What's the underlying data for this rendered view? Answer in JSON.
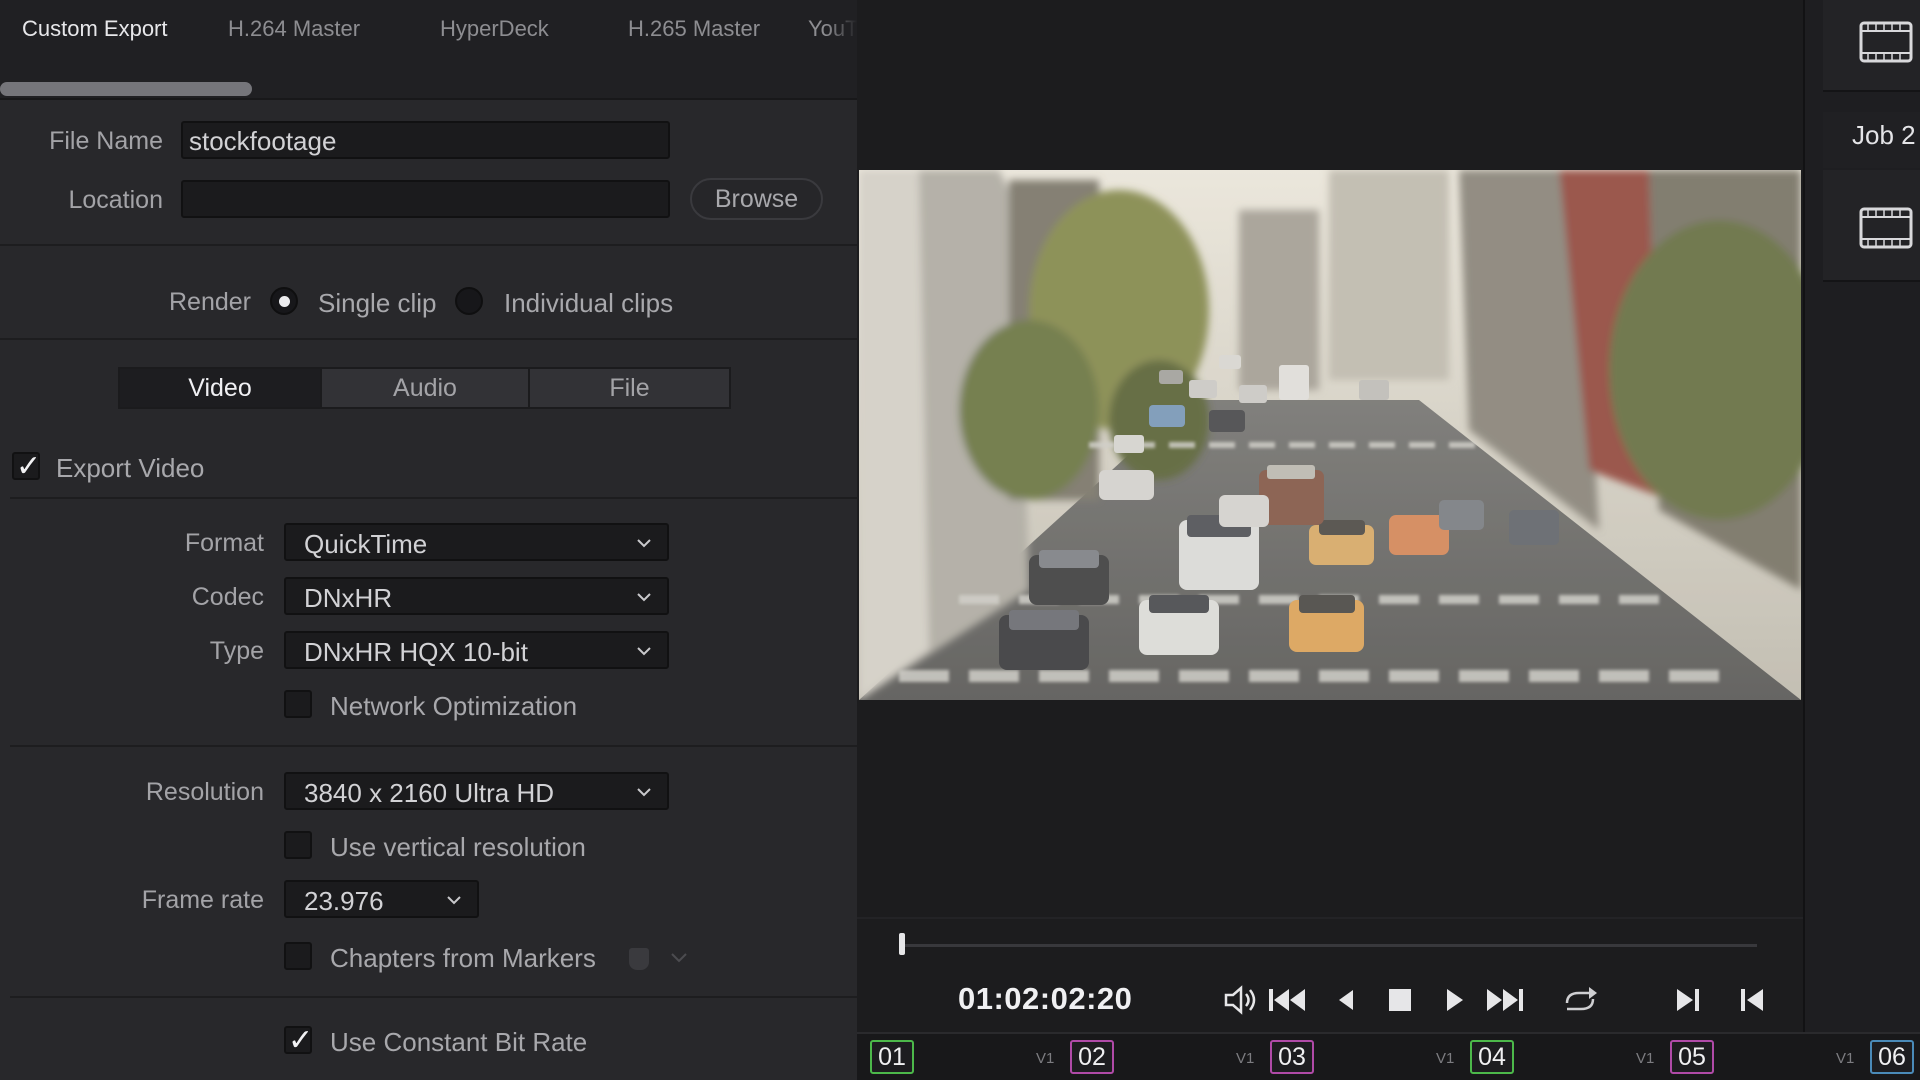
{
  "preset_tabs": [
    "Custom Export",
    "H.264 Master",
    "HyperDeck",
    "H.265 Master",
    "YouT"
  ],
  "file_name": {
    "label": "File Name",
    "value": "stockfootage"
  },
  "location": {
    "label": "Location",
    "value": "",
    "browse_label": "Browse"
  },
  "render": {
    "label": "Render",
    "options": [
      "Single clip",
      "Individual clips"
    ],
    "selected": "Single clip"
  },
  "settings_tabs": [
    "Video",
    "Audio",
    "File"
  ],
  "export_video": {
    "label": "Export Video",
    "checked": true
  },
  "format": {
    "label": "Format",
    "value": "QuickTime"
  },
  "codec": {
    "label": "Codec",
    "value": "DNxHR"
  },
  "type": {
    "label": "Type",
    "value": "DNxHR HQX 10-bit"
  },
  "network_optimization": {
    "label": "Network Optimization",
    "checked": false
  },
  "resolution": {
    "label": "Resolution",
    "value": "3840 x 2160 Ultra HD"
  },
  "vertical_resolution": {
    "label": "Use vertical resolution",
    "checked": false
  },
  "frame_rate": {
    "label": "Frame rate",
    "value": "23.976"
  },
  "chapters": {
    "label": "Chapters from Markers",
    "checked": false
  },
  "constant_bit_rate": {
    "label": "Use Constant Bit Rate",
    "checked": true
  },
  "viewer": {
    "timecode": "01:02:02:20",
    "playhead_fraction": 0.0
  },
  "transport_icons": [
    "volume-icon",
    "skip-to-start-icon",
    "step-back-icon",
    "stop-icon",
    "play-icon",
    "skip-to-end-icon",
    "loop-icon",
    "next-clip-icon",
    "previous-clip-icon"
  ],
  "clips": [
    {
      "track": "",
      "number": "01",
      "color": "#4cb84a"
    },
    {
      "track": "V1",
      "number": "02",
      "color": "#b04aa8"
    },
    {
      "track": "V1",
      "number": "03",
      "color": "#b04aa8"
    },
    {
      "track": "V1",
      "number": "04",
      "color": "#4cb84a"
    },
    {
      "track": "V1",
      "number": "05",
      "color": "#b04aa8"
    },
    {
      "track": "V1",
      "number": "06",
      "color": "#4a8ab8"
    }
  ],
  "render_queue": {
    "job_label": "Job 2"
  }
}
